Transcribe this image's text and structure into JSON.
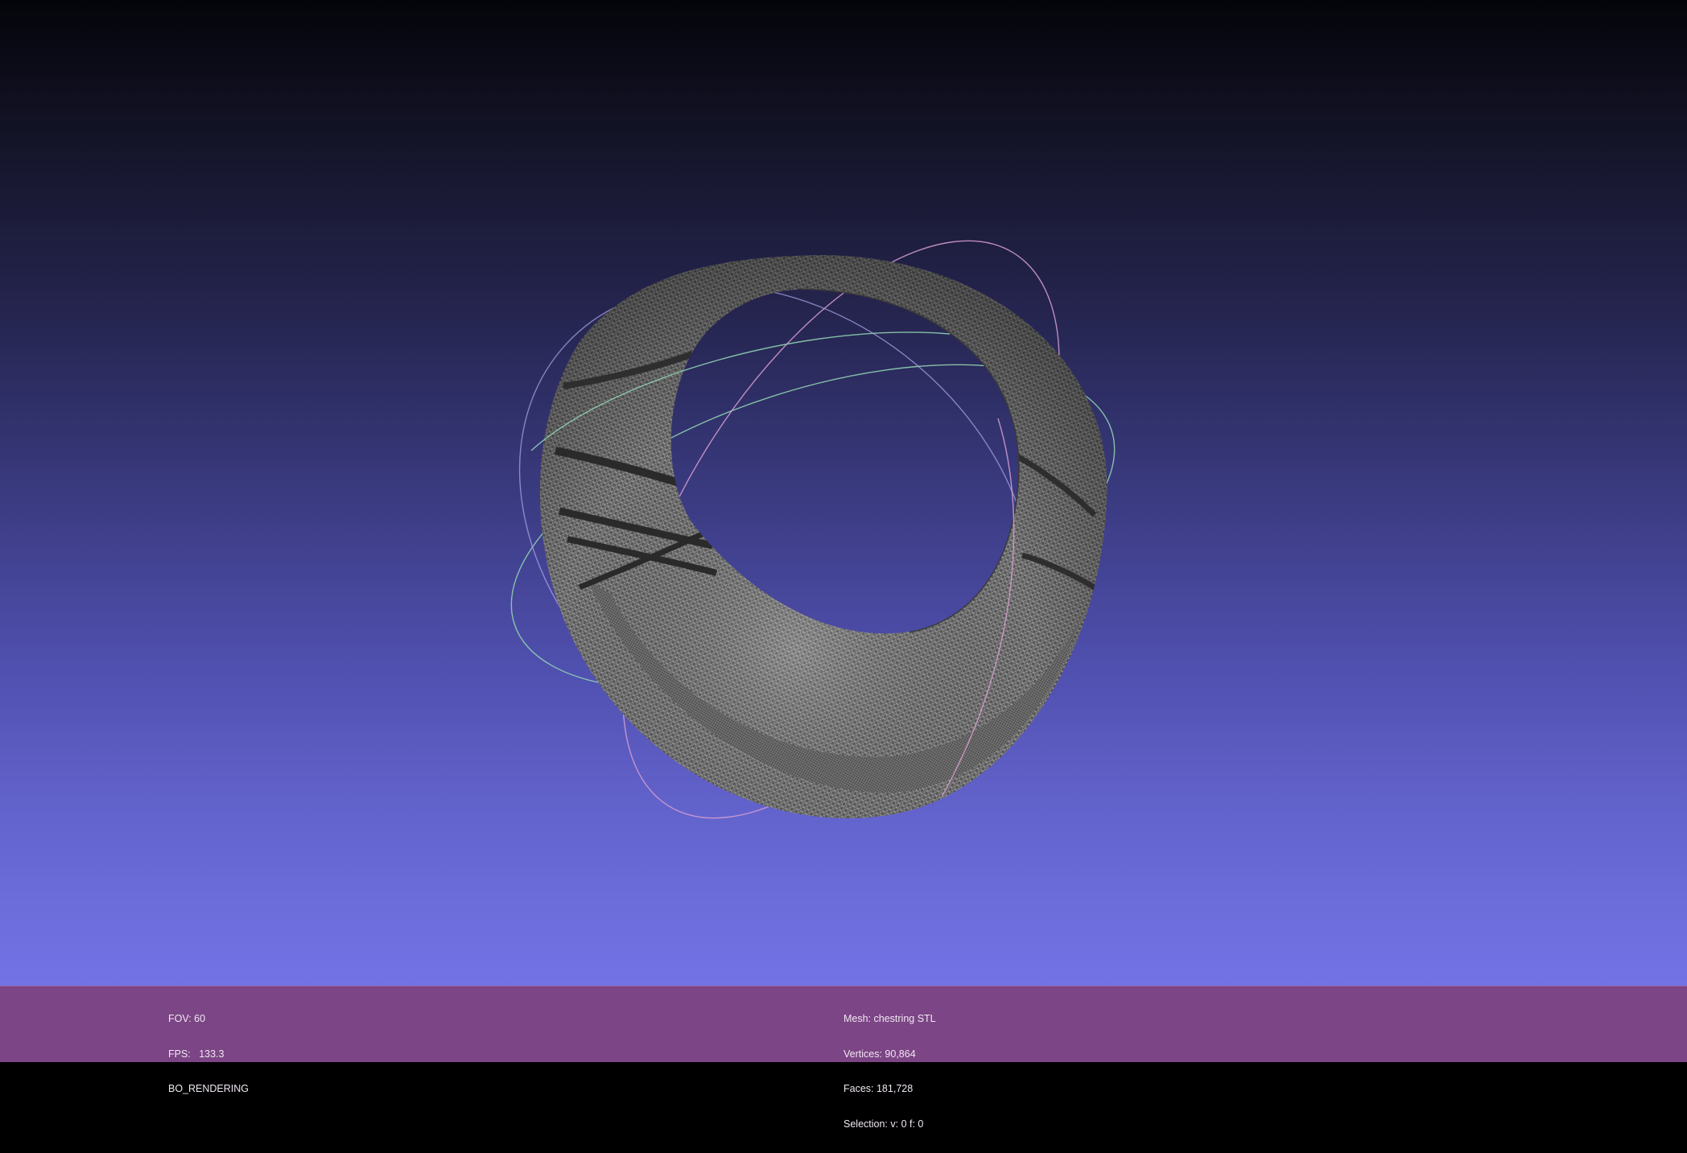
{
  "viewport": {
    "background_top": "#04040a",
    "background_bottom": "#7373e6",
    "mesh_color": "#5a5a5a",
    "trackball_colors": [
      "#d8a0d0",
      "#8fd0b0",
      "#b0a8e8"
    ]
  },
  "status_bar": {
    "background": "#7c4585",
    "left": {
      "fov": "FOV: 60",
      "fps": "FPS:   133.3",
      "render_mode": "BO_RENDERING"
    },
    "right": {
      "mesh": "Mesh: chestring STL",
      "vertices": "Vertices: 90,864",
      "faces": "Faces: 181,728",
      "selection": "Selection: v: 0 f: 0"
    }
  }
}
